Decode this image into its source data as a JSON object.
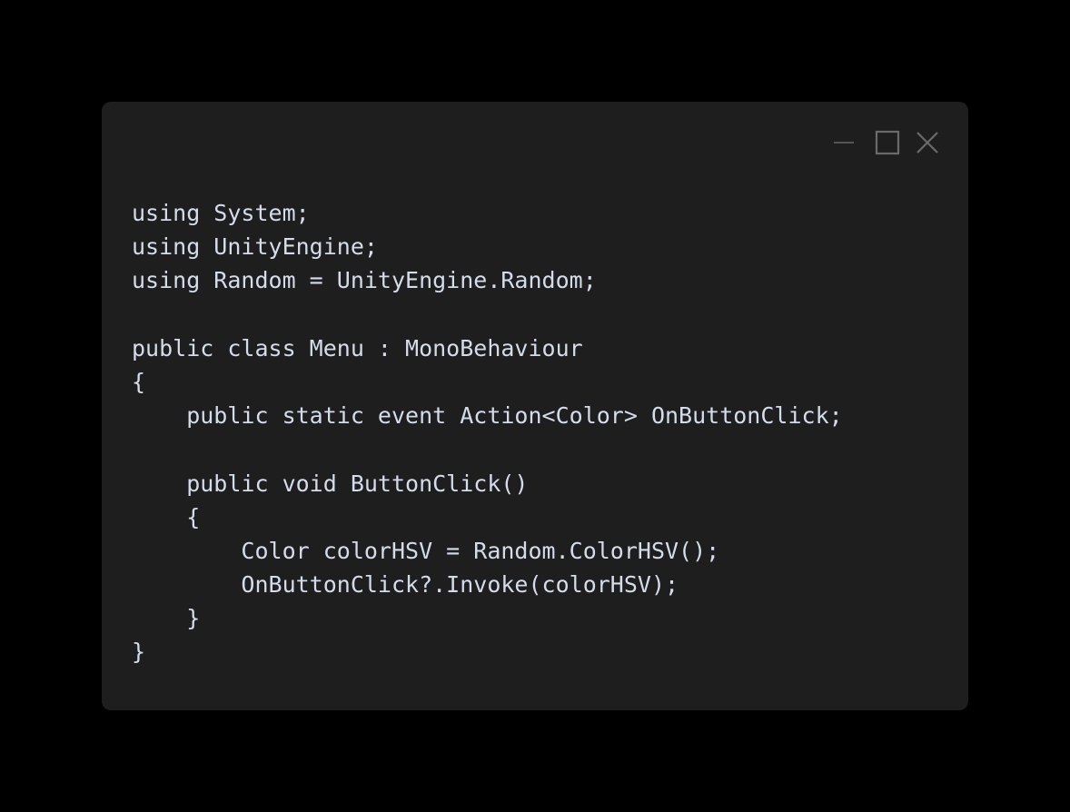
{
  "window": {
    "background": "#1e1e1e",
    "controls": {
      "minimize_icon": "minimize-icon",
      "maximize_icon": "maximize-icon",
      "close_icon": "close-icon"
    }
  },
  "code": {
    "lines": [
      "using System;",
      "using UnityEngine;",
      "using Random = UnityEngine.Random;",
      "",
      "public class Menu : MonoBehaviour",
      "{",
      "    public static event Action<Color> OnButtonClick;",
      "",
      "    public void ButtonClick()",
      "    {",
      "        Color colorHSV = Random.ColorHSV();",
      "        OnButtonClick?.Invoke(colorHSV);",
      "    }",
      "}"
    ]
  }
}
